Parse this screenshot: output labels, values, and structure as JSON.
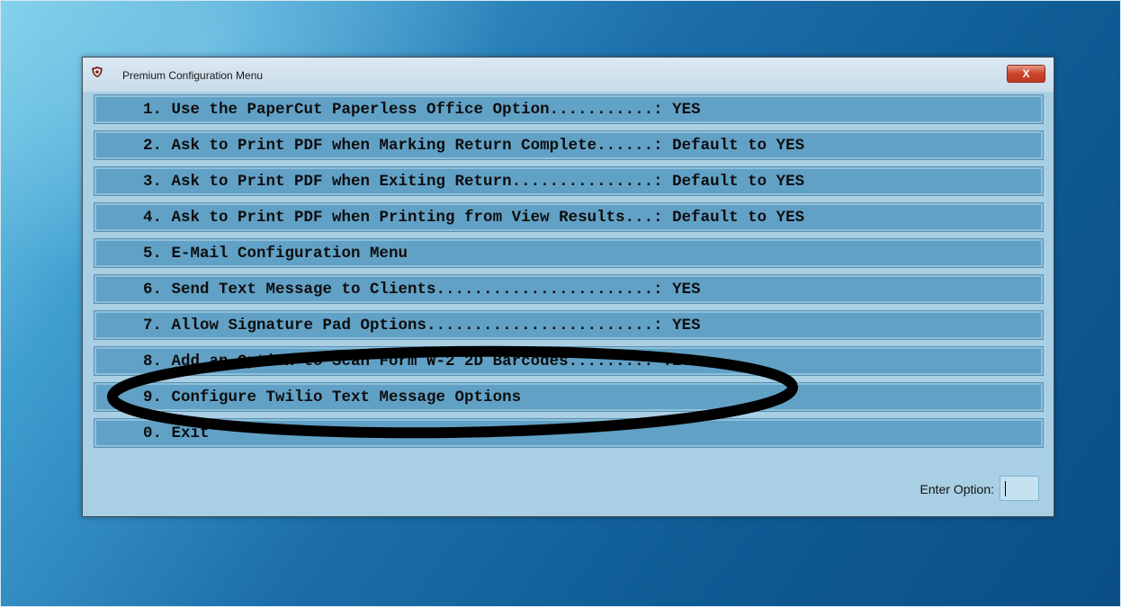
{
  "window": {
    "title": "Premium Configuration Menu",
    "close_label": "X"
  },
  "menu": {
    "items": [
      {
        "text": "1. Use the PaperCut Paperless Office Option...........: YES"
      },
      {
        "text": "2. Ask to Print PDF when Marking Return Complete......: Default to YES"
      },
      {
        "text": "3. Ask to Print PDF when Exiting Return...............: Default to YES"
      },
      {
        "text": "4. Ask to Print PDF when Printing from View Results...: Default to YES"
      },
      {
        "text": "5. E-Mail Configuration Menu"
      },
      {
        "text": "6. Send Text Message to Clients.......................: YES"
      },
      {
        "text": "7. Allow Signature Pad Options........................: YES"
      },
      {
        "text": "8. Add an Option to Scan Form W-2 2D Barcodes........: YES"
      },
      {
        "text": "9. Configure Twilio Text Message Options"
      },
      {
        "text": "0. Exit"
      }
    ]
  },
  "status": {
    "label": "Enter Option:",
    "value": ""
  },
  "colors": {
    "window_bg": "#a9cfe4",
    "item_bg": "#62a1c6",
    "close_red": "#c7452d"
  }
}
